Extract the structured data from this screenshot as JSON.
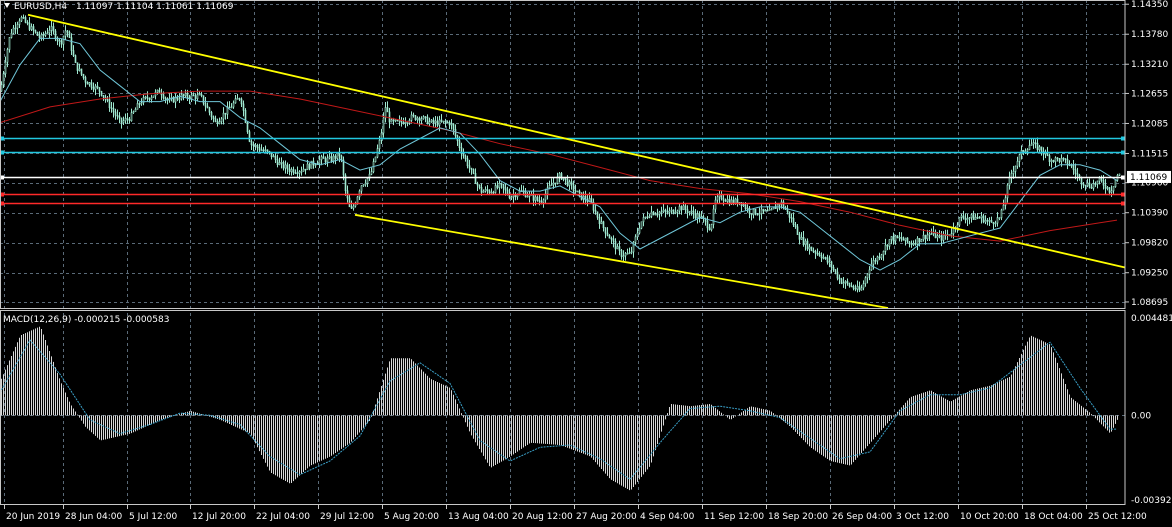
{
  "chart_data": {
    "type": "candlestick",
    "price_pane": {
      "header": {
        "symbol": "EURUSD,H4",
        "ohlc": "1.11097 1.11104 1.11061 1.11069"
      },
      "ylim": [
        1.0858,
        1.1443
      ],
      "y_ticks": [
        "1.14350",
        "1.13780",
        "1.13210",
        "1.12655",
        "1.12085",
        "1.11515",
        "1.10960",
        "1.10390",
        "1.09820",
        "1.09250",
        "1.08695"
      ],
      "current_price": "1.11069",
      "price_series": {
        "x": [
          0,
          5,
          10,
          20,
          30,
          40,
          50,
          60,
          66,
          75,
          85,
          100,
          110,
          120,
          130,
          140,
          150,
          160,
          168,
          180,
          200,
          215,
          230,
          240,
          250,
          260,
          270,
          280,
          290,
          300,
          310,
          320,
          330,
          340,
          345,
          350,
          355,
          360,
          370,
          380,
          385,
          390,
          400,
          410,
          420,
          430,
          440,
          450,
          460,
          470,
          480,
          490,
          500,
          510,
          520,
          530,
          540,
          550,
          560,
          570,
          580,
          590,
          600,
          610,
          620,
          630,
          635,
          640,
          650,
          660,
          670,
          680,
          690,
          700,
          710,
          715,
          720,
          730,
          740,
          750,
          760,
          770,
          780,
          790,
          800,
          810,
          820,
          830,
          840,
          850,
          860,
          870,
          880,
          890,
          900,
          910,
          920,
          930,
          940,
          950,
          960,
          970,
          980,
          990,
          1000,
          1010,
          1020,
          1030,
          1040,
          1050,
          1060,
          1070,
          1080,
          1090,
          1100,
          1110,
          1117
        ],
        "values": [
          1.127,
          1.133,
          1.138,
          1.141,
          1.139,
          1.137,
          1.139,
          1.136,
          1.139,
          1.132,
          1.129,
          1.127,
          1.124,
          1.121,
          1.122,
          1.125,
          1.126,
          1.127,
          1.125,
          1.126,
          1.126,
          1.121,
          1.124,
          1.126,
          1.117,
          1.116,
          1.115,
          1.113,
          1.112,
          1.112,
          1.113,
          1.114,
          1.114,
          1.115,
          1.108,
          1.104,
          1.106,
          1.109,
          1.111,
          1.118,
          1.124,
          1.121,
          1.121,
          1.122,
          1.122,
          1.121,
          1.121,
          1.121,
          1.116,
          1.112,
          1.108,
          1.108,
          1.109,
          1.107,
          1.108,
          1.107,
          1.106,
          1.109,
          1.111,
          1.109,
          1.107,
          1.106,
          1.102,
          1.099,
          1.096,
          1.096,
          1.099,
          1.102,
          1.104,
          1.104,
          1.104,
          1.105,
          1.104,
          1.103,
          1.101,
          1.106,
          1.107,
          1.106,
          1.106,
          1.104,
          1.104,
          1.104,
          1.106,
          1.103,
          1.099,
          1.097,
          1.096,
          1.094,
          1.091,
          1.09,
          1.089,
          1.094,
          1.096,
          1.099,
          1.099,
          1.098,
          1.099,
          1.1,
          1.099,
          1.1,
          1.103,
          1.103,
          1.103,
          1.102,
          1.103,
          1.111,
          1.115,
          1.117,
          1.116,
          1.114,
          1.114,
          1.113,
          1.11,
          1.109,
          1.11,
          1.108,
          1.111
        ]
      },
      "ma_fast": {
        "x": [
          0,
          20,
          40,
          60,
          80,
          100,
          120,
          140,
          160,
          180,
          200,
          220,
          240,
          260,
          280,
          300,
          320,
          340,
          360,
          380,
          400,
          420,
          440,
          460,
          480,
          500,
          520,
          540,
          560,
          580,
          600,
          620,
          640,
          660,
          680,
          700,
          720,
          740,
          760,
          780,
          800,
          820,
          840,
          860,
          880,
          900,
          920,
          940,
          960,
          980,
          1000,
          1020,
          1040,
          1060,
          1080,
          1100,
          1117
        ],
        "values": [
          1.125,
          1.132,
          1.137,
          1.137,
          1.136,
          1.131,
          1.128,
          1.125,
          1.125,
          1.126,
          1.125,
          1.125,
          1.122,
          1.12,
          1.117,
          1.114,
          1.113,
          1.114,
          1.112,
          1.113,
          1.116,
          1.118,
          1.12,
          1.119,
          1.115,
          1.11,
          1.108,
          1.108,
          1.109,
          1.107,
          1.105,
          1.1,
          1.097,
          1.099,
          1.101,
          1.103,
          1.102,
          1.104,
          1.105,
          1.105,
          1.104,
          1.101,
          1.098,
          1.095,
          1.093,
          1.095,
          1.098,
          1.098,
          1.099,
          1.1,
          1.101,
          1.106,
          1.111,
          1.113,
          1.113,
          1.112,
          1.11
        ]
      },
      "ma_slow": {
        "x": [
          0,
          50,
          100,
          150,
          200,
          250,
          300,
          350,
          400,
          450,
          500,
          550,
          600,
          650,
          700,
          750,
          800,
          850,
          900,
          950,
          1000,
          1050,
          1100,
          1117
        ],
        "values": [
          1.121,
          1.124,
          1.1255,
          1.1265,
          1.127,
          1.127,
          1.1255,
          1.1235,
          1.1215,
          1.1195,
          1.117,
          1.115,
          1.1125,
          1.11,
          1.1085,
          1.1075,
          1.106,
          1.104,
          1.1015,
          1.0995,
          1.0985,
          1.1005,
          1.102,
          1.1025
        ]
      },
      "trendlines": [
        {
          "color": "#ffff00",
          "x1": 28,
          "y1": 1.1415,
          "x2": 1125,
          "y2": 1.0935
        },
        {
          "color": "#ffff00",
          "x1": 355,
          "y1": 1.1035,
          "x2": 888,
          "y2": 1.0858
        }
      ],
      "horizontal_lines": [
        {
          "color": "#21c8e0",
          "value": 1.118
        },
        {
          "color": "#21c8e0",
          "value": 1.1155
        },
        {
          "color": "#ffffff",
          "value": 1.11069
        },
        {
          "color": "#ff2a2a",
          "value": 1.1075
        },
        {
          "color": "#ff2a2a",
          "value": 1.1058
        }
      ]
    },
    "macd_pane": {
      "header": "MACD(12,26,9) -0.000215 -0.000583",
      "ylim": [
        -0.003925,
        0.004481
      ],
      "y_ticks": [
        "0.004481",
        "0.00",
        "-0.003925"
      ],
      "histogram": {
        "x": [
          0,
          20,
          40,
          60,
          70,
          85,
          100,
          130,
          160,
          190,
          220,
          250,
          270,
          290,
          310,
          330,
          350,
          370,
          390,
          410,
          430,
          450,
          470,
          490,
          510,
          530,
          560,
          590,
          610,
          630,
          650,
          670,
          690,
          710,
          730,
          750,
          770,
          790,
          810,
          830,
          850,
          870,
          890,
          910,
          930,
          950,
          970,
          990,
          1010,
          1030,
          1050,
          1070,
          1090,
          1110,
          1117
        ],
        "values": [
          0.0015,
          0.0035,
          0.0039,
          0.0015,
          0.0005,
          -0.0005,
          -0.0011,
          -0.0008,
          -0.0002,
          0.0002,
          -0.0002,
          -0.0008,
          -0.0025,
          -0.003,
          -0.0022,
          -0.0018,
          -0.0012,
          -0.0002,
          0.0025,
          0.0025,
          0.0016,
          0.0012,
          -0.0008,
          -0.0023,
          -0.0018,
          -0.0012,
          -0.0013,
          -0.0018,
          -0.0028,
          -0.0033,
          -0.0022,
          0.0005,
          0.0004,
          0.0005,
          -0.0002,
          0.0004,
          0.0002,
          -0.0005,
          -0.0014,
          -0.002,
          -0.0022,
          -0.0012,
          -0.0002,
          0.0008,
          0.0011,
          0.0006,
          0.0011,
          0.0013,
          0.0017,
          0.0035,
          0.0031,
          0.0008,
          0.0001,
          -0.0008,
          -0.0002
        ]
      },
      "signal": {
        "x": [
          0,
          30,
          60,
          90,
          120,
          150,
          180,
          210,
          240,
          270,
          300,
          330,
          360,
          390,
          420,
          450,
          480,
          510,
          540,
          570,
          600,
          630,
          660,
          690,
          720,
          750,
          780,
          810,
          840,
          870,
          900,
          930,
          960,
          990,
          1020,
          1050,
          1080,
          1110,
          1117
        ],
        "values": [
          0.001,
          0.0033,
          0.0018,
          -0.0002,
          -0.0008,
          -0.0004,
          0.0001,
          0.0,
          -0.0004,
          -0.0018,
          -0.0026,
          -0.002,
          -0.0009,
          0.0015,
          0.0023,
          0.0014,
          -0.0011,
          -0.002,
          -0.0014,
          -0.0013,
          -0.0019,
          -0.0028,
          -0.0012,
          0.0003,
          0.0004,
          0.0002,
          -0.0001,
          -0.001,
          -0.0019,
          -0.0016,
          0.0002,
          0.0009,
          0.0009,
          0.0012,
          0.0022,
          0.0032,
          0.0012,
          -0.0006,
          -0.0006
        ]
      }
    },
    "x_ticks": [
      {
        "x": 4,
        "label": "20 Jun 2019"
      },
      {
        "x": 63,
        "label": "28 Jun 04:00"
      },
      {
        "x": 127,
        "label": "5 Jul 12:00"
      },
      {
        "x": 190,
        "label": "12 Jul 20:00"
      },
      {
        "x": 254,
        "label": "22 Jul 04:00"
      },
      {
        "x": 318,
        "label": "29 Jul 12:00"
      },
      {
        "x": 382,
        "label": "5 Aug 20:00"
      },
      {
        "x": 446,
        "label": "13 Aug 04:00"
      },
      {
        "x": 510,
        "label": "20 Aug 12:00"
      },
      {
        "x": 574,
        "label": "27 Aug 20:00"
      },
      {
        "x": 638,
        "label": "4 Sep 04:00"
      },
      {
        "x": 702,
        "label": "11 Sep 12:00"
      },
      {
        "x": 766,
        "label": "18 Sep 20:00"
      },
      {
        "x": 830,
        "label": "26 Sep 04:00"
      },
      {
        "x": 894,
        "label": "3 Oct 12:00"
      },
      {
        "x": 958,
        "label": "10 Oct 20:00"
      },
      {
        "x": 1022,
        "label": "18 Oct 04:00"
      },
      {
        "x": 1086,
        "label": "25 Oct 12:00"
      }
    ],
    "colors": {
      "background": "#000000",
      "grid": "#5a6a78",
      "frame": "#c8c8c8",
      "candle": "#9fe8d0",
      "ma_fast": "#6fc6d8",
      "ma_slow": "#c01818",
      "macd_histogram": "#d8d8d8",
      "macd_signal": "#3aa0c8",
      "text": "#ffffff"
    }
  }
}
